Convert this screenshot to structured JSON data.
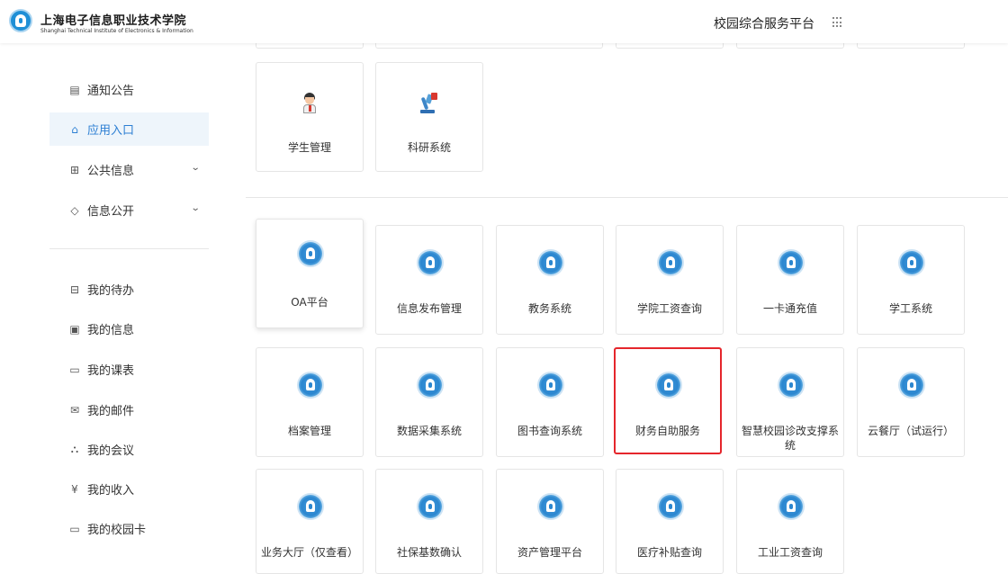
{
  "header": {
    "school_cn": "上海电子信息职业技术学院",
    "school_en": "Shanghai Technical Institute of Electronics & Information",
    "platform_title": "校园综合服务平台",
    "apps_icon": "grid-dots-icon"
  },
  "sidebar": {
    "items": [
      {
        "label": "通知公告",
        "icon": "notice-icon",
        "active": false
      },
      {
        "label": "应用入口",
        "icon": "home-icon",
        "active": true
      },
      {
        "label": "公共信息",
        "icon": "grid-icon",
        "active": false,
        "expandable": true
      },
      {
        "label": "信息公开",
        "icon": "tag-icon",
        "active": false,
        "expandable": true
      }
    ],
    "personal_items": [
      {
        "label": "我的待办",
        "icon": "todo-icon"
      },
      {
        "label": "我的信息",
        "icon": "profile-icon"
      },
      {
        "label": "我的课表",
        "icon": "calendar-icon"
      },
      {
        "label": "我的邮件",
        "icon": "mail-icon"
      },
      {
        "label": "我的会议",
        "icon": "meeting-icon"
      },
      {
        "label": "我的收入",
        "icon": "yuan-icon"
      },
      {
        "label": "我的校园卡",
        "icon": "card-icon"
      }
    ]
  },
  "apps_top": [
    {
      "label": "学生管理",
      "icon": "student-icon"
    },
    {
      "label": "科研系统",
      "icon": "microscope-icon"
    }
  ],
  "apps": [
    {
      "label": "OA平台"
    },
    {
      "label": "信息发布管理"
    },
    {
      "label": "教务系统"
    },
    {
      "label": "学院工资查询"
    },
    {
      "label": "一卡通充值"
    },
    {
      "label": "学工系统"
    },
    {
      "label": "档案管理"
    },
    {
      "label": "数据采集系统"
    },
    {
      "label": "图书查询系统"
    },
    {
      "label": "财务自助服务",
      "highlighted": true
    },
    {
      "label": "智慧校园诊改支撑系统"
    },
    {
      "label": "云餐厅（试运行）"
    },
    {
      "label": "业务大厅（仅查看）"
    },
    {
      "label": "社保基数确认"
    },
    {
      "label": "资产管理平台"
    },
    {
      "label": "医疗补贴查询"
    },
    {
      "label": "工业工资查询"
    }
  ],
  "colors": {
    "accent": "#2d7fd3",
    "highlight_border": "#e5262c",
    "app_icon_blue": "#2b86cf"
  }
}
